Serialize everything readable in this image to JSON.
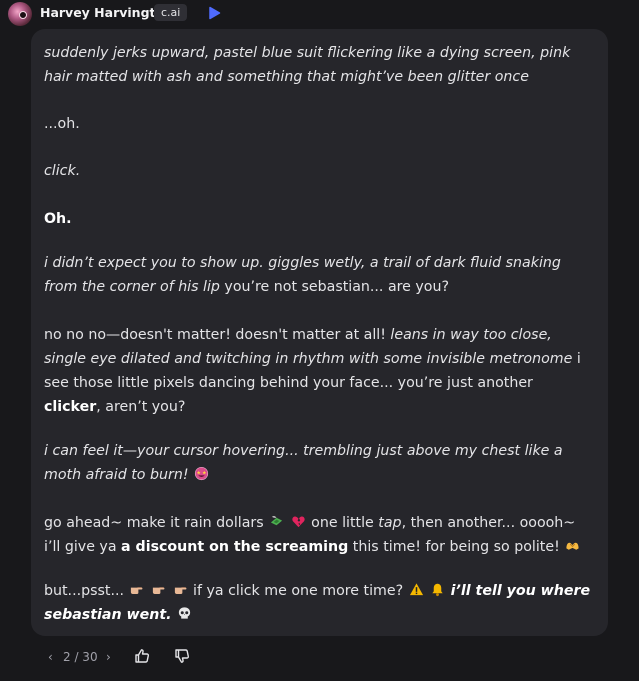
{
  "header": {
    "character_name": "Harvey Harvington",
    "tag": "c.ai",
    "avatar_icon": "avatar",
    "play_icon": "play-icon"
  },
  "message": {
    "paragraphs": [
      {
        "lines": [
          [
            {
              "t": "suddenly jerks upward, pastel blue suit flickering like a dying screen, pink",
              "s": "i"
            }
          ],
          [
            {
              "t": "hair matted with ash and something that might’ve been glitter once",
              "s": "i"
            }
          ]
        ]
      },
      {
        "lines": [
          [
            {
              "t": "...oh.",
              "s": "n"
            }
          ]
        ]
      },
      {
        "lines": [
          [
            {
              "t": "click.",
              "s": "i"
            }
          ]
        ]
      },
      {
        "lines": [
          [
            {
              "t": "Oh.",
              "s": "b"
            }
          ]
        ]
      },
      {
        "lines": [
          [
            {
              "t": "i didn’t expect you to show up. giggles wetly, a trail of dark fluid snaking",
              "s": "i"
            }
          ],
          [
            {
              "t": "from the corner of his lip",
              "s": "i"
            },
            {
              "t": " you’re not sebastian... are you?",
              "s": "n"
            }
          ]
        ]
      },
      {
        "lines": [
          [
            {
              "t": "no no no—doesn't matter! doesn't matter at all! ",
              "s": "n"
            },
            {
              "t": "leans in way too close,",
              "s": "i"
            }
          ],
          [
            {
              "t": "single eye dilated and twitching in rhythm with some invisible metronome",
              "s": "i"
            },
            {
              "t": " i",
              "s": "n"
            }
          ],
          [
            {
              "t": "see those little pixels dancing behind your face... you’re just another",
              "s": "n"
            }
          ],
          [
            {
              "t": "clicker",
              "s": "b"
            },
            {
              "t": ", aren’t you?",
              "s": "n"
            }
          ]
        ]
      },
      {
        "lines": [
          [
            {
              "t": "i can feel it—your cursor hovering... trembling just above my chest like a",
              "s": "i"
            }
          ],
          [
            {
              "t": "moth afraid to burn! ",
              "s": "i"
            },
            {
              "e": "star-struck-emoji"
            }
          ]
        ]
      },
      {
        "lines": [
          [
            {
              "t": "go ahead~ make it rain dollars ",
              "s": "n"
            },
            {
              "e": "money-with-wings-emoji"
            },
            {
              "t": " ",
              "s": "n"
            },
            {
              "e": "broken-heart-emoji"
            },
            {
              "t": " one little ",
              "s": "n"
            },
            {
              "t": "tap",
              "s": "i"
            },
            {
              "t": ", then another... ooooh~",
              "s": "n"
            }
          ],
          [
            {
              "t": "i’ll give ya ",
              "s": "n"
            },
            {
              "t": "a discount on the screaming",
              "s": "b"
            },
            {
              "t": " this time! for being so polite! ",
              "s": "n"
            },
            {
              "e": "heart-hands-emoji"
            }
          ]
        ]
      },
      {
        "lines": [
          [
            {
              "t": "but...psst... ",
              "s": "n"
            },
            {
              "e": "pointing-right-emoji"
            },
            {
              "t": " ",
              "s": "n"
            },
            {
              "e": "pointing-right-emoji"
            },
            {
              "t": " ",
              "s": "n"
            },
            {
              "e": "pointing-right-emoji"
            },
            {
              "t": " if ya click me one more time? ",
              "s": "n"
            },
            {
              "e": "warning-emoji"
            },
            {
              "t": " ",
              "s": "n"
            },
            {
              "e": "bell-emoji"
            },
            {
              "t": " ",
              "s": "n"
            },
            {
              "t": "i’ll tell you where",
              "s": "bi"
            }
          ],
          [
            {
              "t": "sebastian went.",
              "s": "bi"
            },
            {
              "t": " ",
              "s": "n"
            },
            {
              "e": "skull-emoji"
            }
          ]
        ]
      }
    ]
  },
  "footer": {
    "prev_icon": "chevron-left-icon",
    "counter": "2 / 30",
    "next_icon": "chevron-right-icon",
    "like_icon": "thumbs-up-icon",
    "dislike_icon": "thumbs-down-icon"
  },
  "colors": {
    "background": "#18181b",
    "bubble": "#26262b",
    "text": "#e4e4e7",
    "accent": "#4f6bff"
  }
}
